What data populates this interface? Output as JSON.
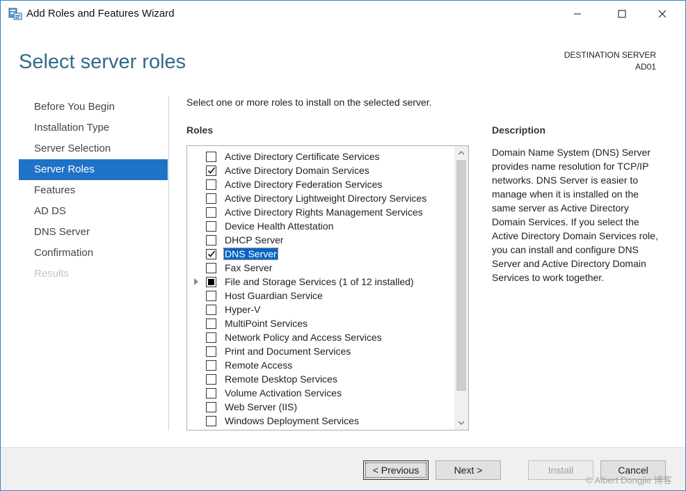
{
  "window": {
    "title": "Add Roles and Features Wizard"
  },
  "header": {
    "page_title": "Select server roles",
    "destination_label": "DESTINATION SERVER",
    "destination_server": "AD01"
  },
  "nav": {
    "items": [
      {
        "label": "Before You Begin",
        "state": "normal"
      },
      {
        "label": "Installation Type",
        "state": "normal"
      },
      {
        "label": "Server Selection",
        "state": "normal"
      },
      {
        "label": "Server Roles",
        "state": "active"
      },
      {
        "label": "Features",
        "state": "normal"
      },
      {
        "label": "AD DS",
        "state": "normal"
      },
      {
        "label": "DNS Server",
        "state": "normal"
      },
      {
        "label": "Confirmation",
        "state": "normal"
      },
      {
        "label": "Results",
        "state": "disabled"
      }
    ]
  },
  "main": {
    "instruction": "Select one or more roles to install on the selected server.",
    "roles_heading": "Roles",
    "description_heading": "Description",
    "description": "Domain Name System (DNS) Server provides name resolution for TCP/IP networks. DNS Server is easier to manage when it is installed on the same server as Active Directory Domain Services. If you select the Active Directory Domain Services role, you can install and configure DNS Server and Active Directory Domain Services to work together."
  },
  "roles": [
    {
      "label": "Active Directory Certificate Services",
      "state": "unchecked"
    },
    {
      "label": "Active Directory Domain Services",
      "state": "checked"
    },
    {
      "label": "Active Directory Federation Services",
      "state": "unchecked"
    },
    {
      "label": "Active Directory Lightweight Directory Services",
      "state": "unchecked"
    },
    {
      "label": "Active Directory Rights Management Services",
      "state": "unchecked"
    },
    {
      "label": "Device Health Attestation",
      "state": "unchecked"
    },
    {
      "label": "DHCP Server",
      "state": "unchecked"
    },
    {
      "label": "DNS Server",
      "state": "checked",
      "selected": true
    },
    {
      "label": "Fax Server",
      "state": "unchecked"
    },
    {
      "label": "File and Storage Services (1 of 12 installed)",
      "state": "partial",
      "expandable": true
    },
    {
      "label": "Host Guardian Service",
      "state": "unchecked"
    },
    {
      "label": "Hyper-V",
      "state": "unchecked"
    },
    {
      "label": "MultiPoint Services",
      "state": "unchecked"
    },
    {
      "label": "Network Policy and Access Services",
      "state": "unchecked"
    },
    {
      "label": "Print and Document Services",
      "state": "unchecked"
    },
    {
      "label": "Remote Access",
      "state": "unchecked"
    },
    {
      "label": "Remote Desktop Services",
      "state": "unchecked"
    },
    {
      "label": "Volume Activation Services",
      "state": "unchecked"
    },
    {
      "label": "Web Server (IIS)",
      "state": "unchecked"
    },
    {
      "label": "Windows Deployment Services",
      "state": "unchecked"
    }
  ],
  "footer": {
    "previous_label": "< Previous",
    "next_label": "Next >",
    "install_label": "Install",
    "cancel_label": "Cancel"
  },
  "watermark": "© Albert Dongjie 博客",
  "colors": {
    "accent": "#1e73c6",
    "title": "#2f6b87",
    "selection": "#0a64c4"
  }
}
